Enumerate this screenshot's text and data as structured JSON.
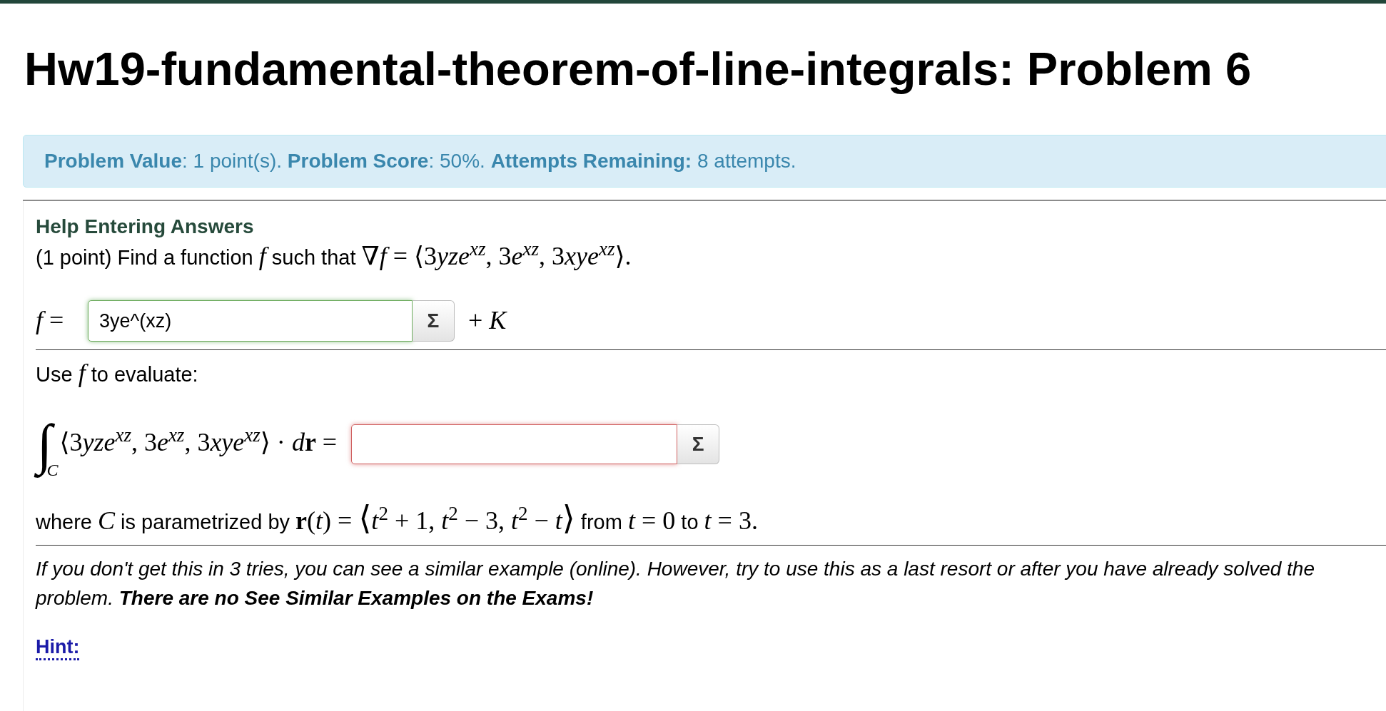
{
  "page": {
    "title": "Hw19-fundamental-theorem-of-line-integrals: Problem 6"
  },
  "info_bar": {
    "text": "**Problem Value**: 1 point(s). **Problem Score**: 50%. **Attempts Remaining:** 8 attempts."
  },
  "problem": {
    "help_link": "Help Entering Answers",
    "prompt": [
      {
        "kind": "text",
        "text": "(1 point) Find a function "
      },
      {
        "kind": "var",
        "text": "f"
      },
      {
        "kind": "text",
        "text": " such that "
      },
      {
        "kind": "math",
        "text": "∇"
      },
      {
        "kind": "var",
        "text": "f"
      },
      {
        "kind": "math",
        "text": " = ⟨3"
      },
      {
        "kind": "var",
        "text": "yze$^{xz}$"
      },
      {
        "kind": "math",
        "text": ", 3"
      },
      {
        "kind": "var",
        "text": "e$^{xz}$"
      },
      {
        "kind": "math",
        "text": ", 3"
      },
      {
        "kind": "var",
        "text": "xye$^{xz}$"
      },
      {
        "kind": "math",
        "text": "⟩."
      }
    ],
    "answer_1": {
      "label": [
        {
          "kind": "var",
          "text": "f"
        },
        {
          "kind": "math",
          "text": " ="
        }
      ],
      "value": "3ye^(xz)",
      "correct": true,
      "editor_button": "Σ",
      "suffix": [
        {
          "kind": "math",
          "text": "+ "
        },
        {
          "kind": "var",
          "text": "K"
        }
      ]
    },
    "instruction": [
      {
        "kind": "text",
        "text": "Use "
      },
      {
        "kind": "var",
        "text": "f"
      },
      {
        "kind": "text",
        "text": " to evaluate:"
      }
    ],
    "integral": {
      "sign": "∫",
      "domain": "C",
      "integrand": [
        {
          "kind": "math",
          "text": "⟨3"
        },
        {
          "kind": "var",
          "text": "yze$^{xz}$"
        },
        {
          "kind": "math",
          "text": ", 3"
        },
        {
          "kind": "var",
          "text": "e$^{xz}$"
        },
        {
          "kind": "math",
          "text": ", 3"
        },
        {
          "kind": "var",
          "text": "xye$^{xz}$"
        },
        {
          "kind": "math",
          "text": "⟩ · "
        },
        {
          "kind": "var",
          "text": "d"
        },
        {
          "kind": "math",
          "text": "**r** ="
        }
      ],
      "answer": {
        "correct": false,
        "editor_button": "Σ"
      }
    },
    "parametrization": [
      {
        "kind": "text",
        "text": "where "
      },
      {
        "kind": "var",
        "text": "C"
      },
      {
        "kind": "text",
        "text": " is parametrized by "
      },
      {
        "kind": "math",
        "text": "**r**("
      },
      {
        "kind": "var",
        "text": "t"
      },
      {
        "kind": "math",
        "text": ") = "
      },
      {
        "kind": "delim",
        "text": "⟨"
      },
      {
        "kind": "var",
        "text": "t"
      },
      {
        "kind": "math",
        "text": "$^{2}$ + 1, "
      },
      {
        "kind": "var",
        "text": "t"
      },
      {
        "kind": "math",
        "text": "$^{2}$ − 3, "
      },
      {
        "kind": "var",
        "text": "t"
      },
      {
        "kind": "math",
        "text": "$^{2}$ − "
      },
      {
        "kind": "var",
        "text": "t"
      },
      {
        "kind": "delim",
        "text": "⟩"
      },
      {
        "kind": "text",
        "text": " from "
      },
      {
        "kind": "var",
        "text": "t"
      },
      {
        "kind": "math",
        "text": " = 0"
      },
      {
        "kind": "text",
        "text": " to "
      },
      {
        "kind": "var",
        "text": "t"
      },
      {
        "kind": "math",
        "text": " = 3."
      }
    ],
    "note": "If you don't get this in 3 tries, you can see a similar example (online). However, try to use this as a last resort or after you have already solved the problem. **There are no See Similar Examples on the Exams!**",
    "hint_link": "Hint:"
  }
}
